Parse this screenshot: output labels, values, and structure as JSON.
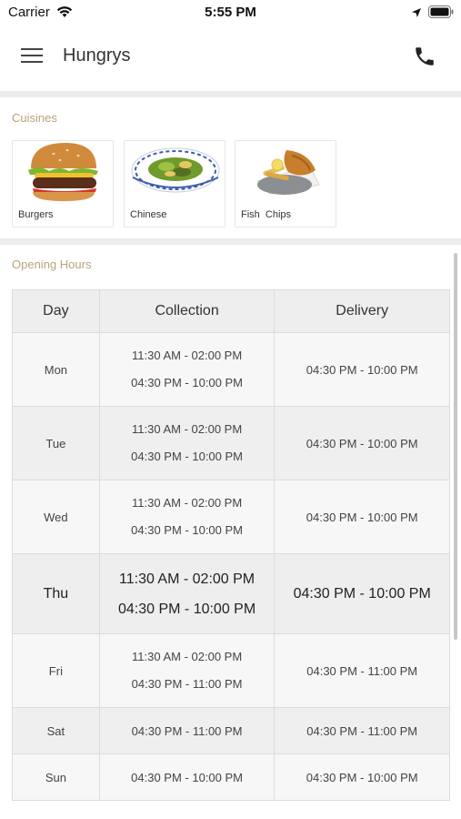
{
  "status_bar": {
    "carrier": "Carrier",
    "time": "5:55 PM"
  },
  "header": {
    "title": "Hungrys"
  },
  "cuisines": {
    "title": "Cuisines",
    "items": [
      {
        "label": "Burgers",
        "icon": "burger-image"
      },
      {
        "label": "Chinese",
        "icon": "chinese-food-image"
      },
      {
        "label": "Fish  Chips",
        "icon": "fish-chips-image"
      }
    ]
  },
  "opening_hours": {
    "title": "Opening Hours",
    "columns": [
      "Day",
      "Collection",
      "Delivery"
    ],
    "rows": [
      {
        "day": "Mon",
        "collection": [
          "11:30 AM - 02:00 PM",
          "04:30 PM - 10:00 PM"
        ],
        "delivery": "04:30 PM - 10:00 PM"
      },
      {
        "day": "Tue",
        "collection": [
          "11:30 AM - 02:00 PM",
          "04:30 PM - 10:00 PM"
        ],
        "delivery": "04:30 PM - 10:00 PM"
      },
      {
        "day": "Wed",
        "collection": [
          "11:30 AM - 02:00 PM",
          "04:30 PM - 10:00 PM"
        ],
        "delivery": "04:30 PM - 10:00 PM"
      },
      {
        "day": "Thu",
        "collection": [
          "11:30 AM - 02:00 PM",
          "04:30 PM - 10:00 PM"
        ],
        "delivery": "04:30 PM - 10:00 PM"
      },
      {
        "day": "Fri",
        "collection": [
          "11:30 AM - 02:00 PM",
          "04:30 PM - 11:00 PM"
        ],
        "delivery": "04:30 PM - 11:00 PM"
      },
      {
        "day": "Sat",
        "collection": [
          "04:30 PM - 11:00 PM"
        ],
        "delivery": "04:30 PM - 11:00 PM"
      },
      {
        "day": "Sun",
        "collection": [
          "04:30 PM - 10:00 PM"
        ],
        "delivery": "04:30 PM - 10:00 PM"
      }
    ]
  },
  "colors": {
    "section_title": "#b9a37b",
    "divider": "#ececec",
    "table_border": "#dcdcdc"
  }
}
